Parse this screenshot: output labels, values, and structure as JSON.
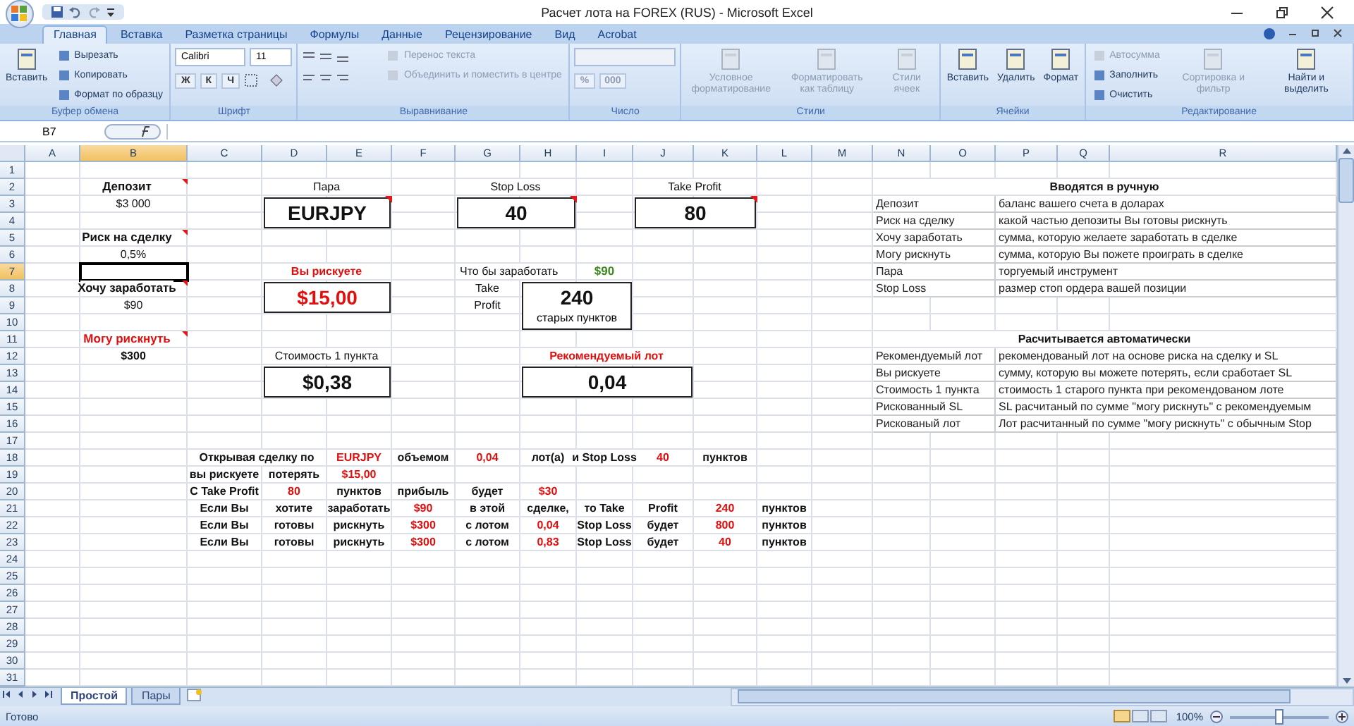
{
  "window": {
    "title": "Расчет лота на FOREX (RUS) - Microsoft Excel"
  },
  "ribbon": {
    "tabs": [
      {
        "label": "Главная",
        "selected": true
      },
      {
        "label": "Вставка",
        "selected": false
      },
      {
        "label": "Разметка страницы",
        "selected": false
      },
      {
        "label": "Формулы",
        "selected": false
      },
      {
        "label": "Данные",
        "selected": false
      },
      {
        "label": "Рецензирование",
        "selected": false
      },
      {
        "label": "Вид",
        "selected": false
      },
      {
        "label": "Acrobat",
        "selected": false
      }
    ],
    "groups": [
      {
        "label": "Буфер обмена",
        "kind": "clipboard",
        "buttons": [
          {
            "label": "Вставить",
            "kind": "big",
            "disabled": false
          },
          {
            "label": "Вырезать",
            "kind": "small",
            "disabled": false
          },
          {
            "label": "Копировать",
            "kind": "small",
            "disabled": false
          },
          {
            "label": "Формат по образцу",
            "kind": "small",
            "disabled": false
          }
        ]
      },
      {
        "label": "Шрифт",
        "kind": "font",
        "font": "Calibri",
        "size": "11",
        "buttons": [
          {
            "label": "Ж",
            "kind": "glyph",
            "disabled": false
          },
          {
            "label": "К",
            "kind": "glyph",
            "disabled": false
          },
          {
            "label": "Ч",
            "kind": "glyph",
            "disabled": false
          }
        ]
      },
      {
        "label": "Выравнивание",
        "kind": "alignment",
        "buttons": [
          {
            "label": "Перенос текста",
            "kind": "small",
            "disabled": true
          },
          {
            "label": "Объединить и поместить в центре",
            "kind": "small",
            "disabled": true
          }
        ]
      },
      {
        "label": "Число",
        "kind": "number",
        "buttons": [
          {
            "label": "%",
            "kind": "glyph",
            "disabled": true
          },
          {
            "label": "000",
            "kind": "glyph",
            "disabled": true
          }
        ]
      },
      {
        "label": "Стили",
        "kind": "styles",
        "buttons": [
          {
            "label": "Условное форматирование",
            "kind": "big",
            "disabled": true
          },
          {
            "label": "Форматировать как таблицу",
            "kind": "big",
            "disabled": true
          },
          {
            "label": "Стили ячеек",
            "kind": "big",
            "disabled": true
          }
        ]
      },
      {
        "label": "Ячейки",
        "kind": "cells",
        "buttons": [
          {
            "label": "Вставить",
            "kind": "big",
            "disabled": false
          },
          {
            "label": "Удалить",
            "kind": "big",
            "disabled": false
          },
          {
            "label": "Формат",
            "kind": "big",
            "disabled": false
          }
        ]
      },
      {
        "label": "Редактирование",
        "kind": "editing",
        "buttons": [
          {
            "label": "Автосумма",
            "kind": "small",
            "disabled": true
          },
          {
            "label": "Заполнить",
            "kind": "small",
            "disabled": false
          },
          {
            "label": "Очистить",
            "kind": "small",
            "disabled": false
          },
          {
            "label": "Сортировка и фильтр",
            "kind": "big",
            "disabled": true
          },
          {
            "label": "Найти и выделить",
            "kind": "big",
            "disabled": false
          }
        ]
      }
    ]
  },
  "formula_bar": {
    "name_box": "B7"
  },
  "columns": [
    {
      "label": "A",
      "selected": false
    },
    {
      "label": "B",
      "selected": true
    },
    {
      "label": "C",
      "selected": false
    },
    {
      "label": "D",
      "selected": false
    },
    {
      "label": "E",
      "selected": false
    },
    {
      "label": "F",
      "selected": false
    },
    {
      "label": "G",
      "selected": false
    },
    {
      "label": "H",
      "selected": false
    },
    {
      "label": "I",
      "selected": false
    },
    {
      "label": "J",
      "selected": false
    },
    {
      "label": "K",
      "selected": false
    },
    {
      "label": "L",
      "selected": false
    },
    {
      "label": "M",
      "selected": false
    },
    {
      "label": "N",
      "selected": false
    },
    {
      "label": "O",
      "selected": false
    },
    {
      "label": "P",
      "selected": false
    },
    {
      "label": "Q",
      "selected": false
    },
    {
      "label": "R",
      "selected": false
    }
  ],
  "rows": [
    {
      "label": "1",
      "selected": false
    },
    {
      "label": "2",
      "selected": false
    },
    {
      "label": "3",
      "selected": false
    },
    {
      "label": "4",
      "selected": false
    },
    {
      "label": "5",
      "selected": false
    },
    {
      "label": "6",
      "selected": false
    },
    {
      "label": "7",
      "selected": true
    },
    {
      "label": "8",
      "selected": false
    },
    {
      "label": "9",
      "selected": false
    },
    {
      "label": "10",
      "selected": false
    },
    {
      "label": "11",
      "selected": false
    },
    {
      "label": "12",
      "selected": false
    },
    {
      "label": "13",
      "selected": false
    },
    {
      "label": "14",
      "selected": false
    },
    {
      "label": "15",
      "selected": false
    },
    {
      "label": "16",
      "selected": false
    },
    {
      "label": "17",
      "selected": false
    },
    {
      "label": "18",
      "selected": false
    },
    {
      "label": "19",
      "selected": false
    },
    {
      "label": "20",
      "selected": false
    },
    {
      "label": "21",
      "selected": false
    },
    {
      "label": "22",
      "selected": false
    },
    {
      "label": "23",
      "selected": false
    },
    {
      "label": "24",
      "selected": false
    },
    {
      "label": "25",
      "selected": false
    },
    {
      "label": "26",
      "selected": false
    },
    {
      "label": "27",
      "selected": false
    },
    {
      "label": "28",
      "selected": false
    },
    {
      "label": "29",
      "selected": false
    },
    {
      "label": "30",
      "selected": false
    },
    {
      "label": "31",
      "selected": false
    }
  ],
  "inputs": [
    {
      "label": "Депозит",
      "value": "$3 000",
      "kind": "input",
      "comment": true
    },
    {
      "label": "Риск на сделку",
      "value": "0,5%",
      "kind": "input",
      "comment": true
    },
    {
      "label": "Хочу заработать",
      "value": "$90",
      "kind": "input",
      "comment": true
    },
    {
      "label": "Могу рискнуть",
      "value": "$300",
      "kind": "computed",
      "comment": true
    }
  ],
  "boxes": [
    {
      "label": "Пара",
      "value": "EURJPY",
      "kind": "input",
      "comment": true
    },
    {
      "label": "Stop Loss",
      "value": "40",
      "kind": "input",
      "comment": true
    },
    {
      "label": "Take Profit",
      "value": "80",
      "kind": "input",
      "comment": true
    },
    {
      "label": "Вы рискуете",
      "value": "$15,00",
      "kind": "risk",
      "comment": false
    },
    {
      "label": "Стоимость 1 пункта",
      "value": "$0,38",
      "kind": "result",
      "comment": false
    },
    {
      "label": "Рекомендуемый лот",
      "value": "0,04",
      "kind": "recommended",
      "comment": false
    }
  ],
  "take_profit_block": {
    "caption": "Что бы заработать",
    "target": "$90",
    "label_lines": [
      "Take",
      "Profit"
    ],
    "value": "240",
    "unit": "старых пунктов"
  },
  "summary": [
    [
      {
        "text": "Открывая сделку по",
        "kind": "text"
      },
      {
        "text": "EURJPY",
        "kind": "value"
      },
      {
        "text": "объемом",
        "kind": "text"
      },
      {
        "text": "0,04",
        "kind": "value"
      },
      {
        "text": "лот(а)",
        "kind": "text"
      },
      {
        "text": "и Stop Loss",
        "kind": "text"
      },
      {
        "text": "40",
        "kind": "value"
      },
      {
        "text": "пунктов",
        "kind": "text"
      }
    ],
    [
      {
        "text": "вы рискуете",
        "kind": "text"
      },
      {
        "text": "потерять",
        "kind": "text"
      },
      {
        "text": "$15,00",
        "kind": "value"
      }
    ],
    [
      {
        "text": "С Take Profit",
        "kind": "text"
      },
      {
        "text": "80",
        "kind": "value"
      },
      {
        "text": "пунктов",
        "kind": "text"
      },
      {
        "text": "прибыль",
        "kind": "text"
      },
      {
        "text": "будет",
        "kind": "text"
      },
      {
        "text": "$30",
        "kind": "value"
      }
    ],
    [
      {
        "text": "Если Вы",
        "kind": "text"
      },
      {
        "text": "хотите",
        "kind": "text"
      },
      {
        "text": "заработать",
        "kind": "text"
      },
      {
        "text": "$90",
        "kind": "value"
      },
      {
        "text": "в этой",
        "kind": "text"
      },
      {
        "text": "сделке,",
        "kind": "text"
      },
      {
        "text": "то Take",
        "kind": "text"
      },
      {
        "text": "Profit",
        "kind": "text"
      },
      {
        "text": "240",
        "kind": "value"
      },
      {
        "text": "пунктов",
        "kind": "text"
      }
    ],
    [
      {
        "text": "Если Вы",
        "kind": "text"
      },
      {
        "text": "готовы",
        "kind": "text"
      },
      {
        "text": "рискнуть",
        "kind": "text"
      },
      {
        "text": "$300",
        "kind": "value"
      },
      {
        "text": "с лотом",
        "kind": "text"
      },
      {
        "text": "0,04",
        "kind": "value"
      },
      {
        "text": "Stop Loss",
        "kind": "text"
      },
      {
        "text": "будет",
        "kind": "text"
      },
      {
        "text": "800",
        "kind": "value"
      },
      {
        "text": "пунктов",
        "kind": "text"
      }
    ],
    [
      {
        "text": "Если Вы",
        "kind": "text"
      },
      {
        "text": "готовы",
        "kind": "text"
      },
      {
        "text": "рискнуть",
        "kind": "text"
      },
      {
        "text": "$300",
        "kind": "value"
      },
      {
        "text": "с лотом",
        "kind": "text"
      },
      {
        "text": "0,83",
        "kind": "value"
      },
      {
        "text": "Stop Loss",
        "kind": "text"
      },
      {
        "text": "будет",
        "kind": "text"
      },
      {
        "text": "40",
        "kind": "value"
      },
      {
        "text": "пунктов",
        "kind": "text"
      }
    ]
  ],
  "reference": [
    {
      "heading": "Вводятся в ручную",
      "entries": [
        {
          "term": "Депозит",
          "description": "баланс вашего счета в доларах"
        },
        {
          "term": "Риск на сделку",
          "description": "какой частью депозиты Вы готовы рискнуть"
        },
        {
          "term": "Хочу заработать",
          "description": "сумма, которую желаете заработать в сделке"
        },
        {
          "term": "Могу рискнуть",
          "description": "сумма, которую Вы пожете проиграть в сделке"
        },
        {
          "term": "Пара",
          "description": "торгуемый инструмент"
        },
        {
          "term": "Stop Loss",
          "description": "размер стоп ордера вашей позиции"
        }
      ]
    },
    {
      "heading": "Расчитывается автоматически",
      "entries": [
        {
          "term": "Рекомендуемый лот",
          "description": "рекомендованый лот на основе риска на сделку и SL"
        },
        {
          "term": "Вы рискуете",
          "description": "сумму, которую вы можете потерять, если сработает SL"
        },
        {
          "term": "Стоимость 1 пункта",
          "description": "стоимость 1 старого пункта при рекомендованом лоте"
        },
        {
          "term": "Рискованный SL",
          "description": "SL расчитаный по сумме \"могу рискнуть\" с рекомендуемым"
        },
        {
          "term": "Рискованый лот",
          "description": "Лот расчитанный по сумме \"могу рискнуть\" с обычным Stop"
        }
      ]
    }
  ],
  "sheet_tabs": [
    {
      "label": "Простой",
      "selected": true
    },
    {
      "label": "Пары",
      "selected": false
    }
  ],
  "status_bar": {
    "status": "Готово",
    "zoom": {
      "label": "100%",
      "level": 0.5
    }
  }
}
